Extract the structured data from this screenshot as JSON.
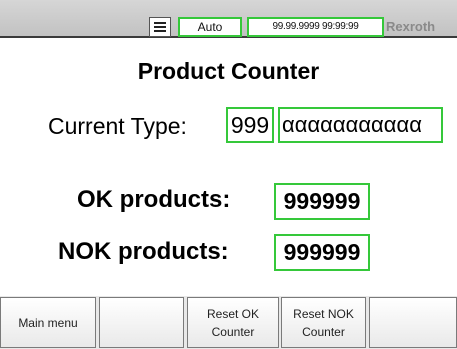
{
  "status_bar": {
    "mode": "Auto",
    "datetime": "99.99.9999 99:99:99",
    "brand": "Rexroth"
  },
  "title": "Product Counter",
  "current_type": {
    "label": "Current Type:",
    "number": "999",
    "name": "ααααααααααα"
  },
  "counters": {
    "ok_label": "OK products:",
    "ok_value": "999999",
    "nok_label": "NOK products:",
    "nok_value": "999999"
  },
  "function_keys": {
    "f1": "Main menu",
    "f2": "",
    "f3": "Reset OK\nCounter",
    "f4": "Reset NOK\nCounter",
    "f5": ""
  },
  "colors": {
    "field_border": "#35c83a",
    "status_bar": "#c8c8c8"
  }
}
